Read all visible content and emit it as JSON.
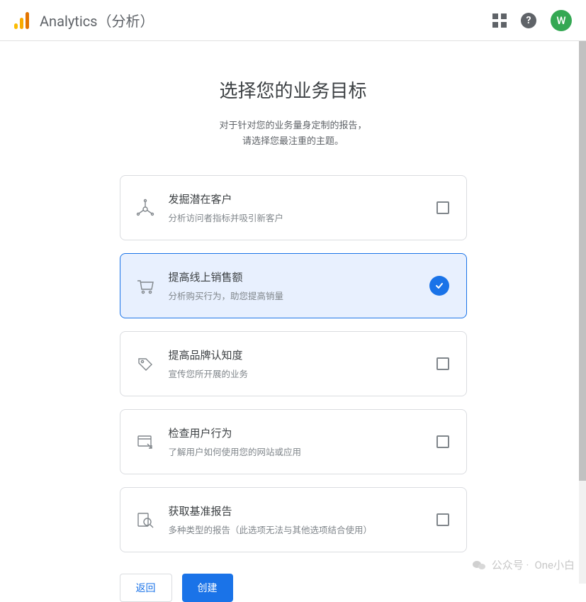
{
  "header": {
    "brand": "Analytics（分析）",
    "avatar_letter": "W",
    "help_symbol": "?"
  },
  "page": {
    "title": "选择您的业务目标",
    "subtitle_line1": "对于针对您的业务量身定制的报告，",
    "subtitle_line2": "请选择您最注重的主题。"
  },
  "options": [
    {
      "id": "leads",
      "title": "发掘潜在客户",
      "desc": "分析访问者指标并吸引新客户",
      "selected": false,
      "icon": "leads-icon"
    },
    {
      "id": "sales",
      "title": "提高线上销售额",
      "desc": "分析购买行为，助您提高销量",
      "selected": true,
      "icon": "cart-icon"
    },
    {
      "id": "brand",
      "title": "提高品牌认知度",
      "desc": "宣传您所开展的业务",
      "selected": false,
      "icon": "tag-icon"
    },
    {
      "id": "behavior",
      "title": "检查用户行为",
      "desc": "了解用户如何使用您的网站或应用",
      "selected": false,
      "icon": "browser-icon"
    },
    {
      "id": "baseline",
      "title": "获取基准报告",
      "desc": "多种类型的报告（此选项无法与其他选项结合使用）",
      "selected": false,
      "icon": "magnify-icon"
    }
  ],
  "actions": {
    "back": "返回",
    "create": "创建"
  },
  "watermark": {
    "prefix": "公众号 ·",
    "name": "One小白"
  }
}
